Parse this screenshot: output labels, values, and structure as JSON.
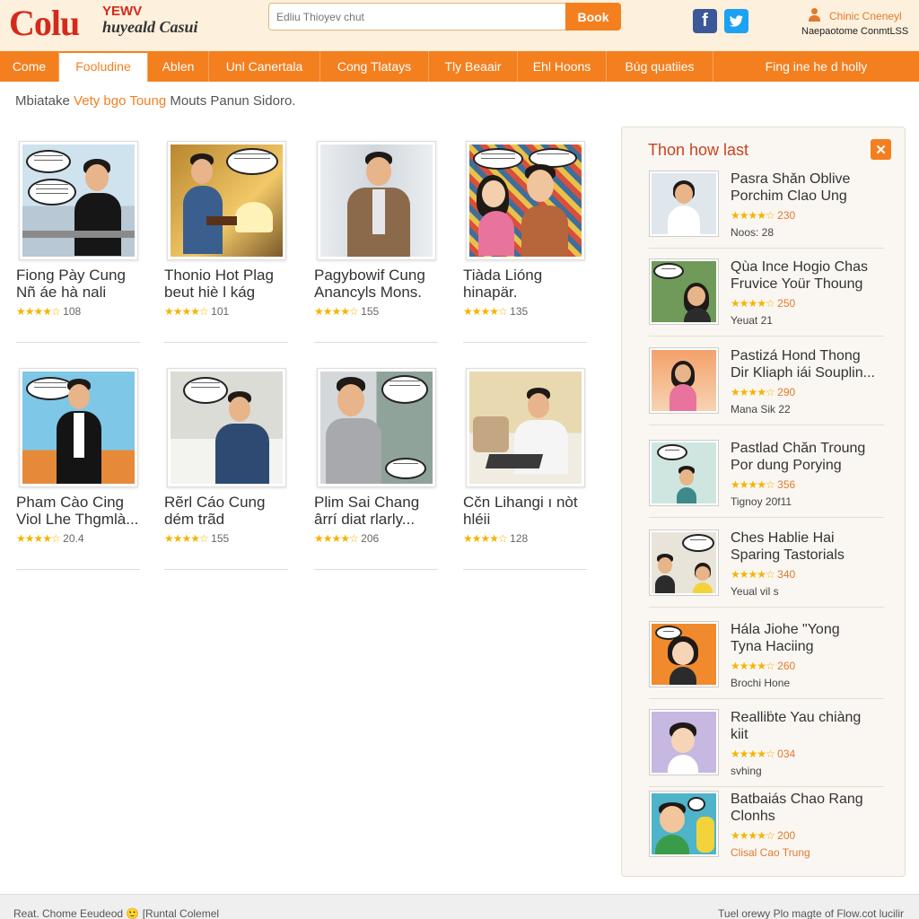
{
  "header": {
    "logo_main": "Colu",
    "logo_top": "YEWV",
    "logo_sub": "huyeald Casui",
    "search_placeholder": "Edliu Thioyev chut",
    "search_button": "Book",
    "social": [
      {
        "icon": "facebook-icon",
        "glyph": "f",
        "color": "#3b5998"
      },
      {
        "icon": "twitter-icon",
        "glyph": "t",
        "color": "#1da1f2"
      }
    ],
    "user_name": "Chinic Cneneyl",
    "user_sub": "Naepaotome ConmtLSS"
  },
  "nav": {
    "items": [
      {
        "label": "Come"
      },
      {
        "label": "Fooludine",
        "active": true
      },
      {
        "label": "Ablen"
      },
      {
        "label": "Unl Canertala"
      },
      {
        "label": "Cong Tlatays"
      },
      {
        "label": "Tly Beaair"
      },
      {
        "label": "Ehl Hoons"
      },
      {
        "label": "Búg quatiies"
      },
      {
        "label": "Fing ine he d holly"
      }
    ]
  },
  "breadcrumb": {
    "before": "Mbiatake ",
    "highlight": "Vety bgo Toung",
    "after": " Mouts Panun Sidoro."
  },
  "grid": [
    {
      "title1": "Fiong Pày Cung",
      "title2": "Nñ áe hà nali",
      "rating": "★★★★☆",
      "count": "108",
      "scene": "bubbles-office"
    },
    {
      "title1": "Thonio Hot Plag",
      "title2": "beut hiè l kág",
      "rating": "★★★★☆",
      "count": "101",
      "scene": "lamp-room"
    },
    {
      "title1": "Pagybowif Cung",
      "title2": "Anancyls Mons.",
      "rating": "★★★★☆",
      "count": "155",
      "scene": "office-jacket"
    },
    {
      "title1": "Tiàda Lióng",
      "title2": "hinapär.",
      "rating": "★★★★☆",
      "count": "135",
      "scene": "comic-couple"
    },
    {
      "title1": "Pham Cào Cing",
      "title2": "Viol Lhe Thgmlà...",
      "rating": "★★★★☆",
      "count": "20.4",
      "scene": "colorful-suit"
    },
    {
      "title1": "Rẽrl Cáo Cung",
      "title2": "dém trãd",
      "rating": "★★★★☆",
      "count": "155",
      "scene": "kitchen-shirt"
    },
    {
      "title1": "Plim Sai Chang",
      "title2": "ârrí diat rlarly...",
      "rating": "★★★★☆",
      "count": "206",
      "scene": "window-suit"
    },
    {
      "title1": "Cčn Lihangi ı nòt",
      "title2": "hléii",
      "rating": "★★★★☆",
      "count": "128",
      "scene": "laptop-sofa"
    }
  ],
  "sidebar": {
    "title": "Thon how last",
    "close_glyph": "✕",
    "items": [
      {
        "title1": "Pasra Shǎn Oblive",
        "title2": "Porchim Clao Ung",
        "rating": "★★★★☆",
        "count": "230",
        "sub": "Noos: 28",
        "scene": "sofa-woman"
      },
      {
        "title1": "Qùa Ince Hogio Chas",
        "title2": "Fruvice Yoür Thoung",
        "rating": "★★★★☆",
        "count": "250",
        "sub": "Yeuat 21",
        "scene": "park-girl"
      },
      {
        "title1": "Pastizá Hond Thong",
        "title2": "Dir Kliaph iái Souplin...",
        "rating": "★★★★☆",
        "count": "290",
        "sub": "Mana Sik 22",
        "scene": "shop-girl"
      },
      {
        "title1": "Pastlad Chăn Troung",
        "title2": "Por dung Porying",
        "rating": "★★★★☆",
        "count": "356",
        "sub": "Tignoy 20f11",
        "scene": "classroom"
      },
      {
        "title1": "Ches Hablie Hai",
        "title2": "Sparing Tastorials",
        "rating": "★★★★☆",
        "count": "340",
        "sub": "Yeual vil s",
        "scene": "tablet"
      },
      {
        "title1": "Hála Jiohe \"Yong",
        "title2": "Tyna Haciing",
        "rating": "★★★★☆",
        "count": "260",
        "sub": "Brochi Hone",
        "scene": "orange-girl"
      },
      {
        "title1": "Realliḃte Yau chiàng",
        "title2": "kiit",
        "rating": "★★★★☆",
        "count": "034",
        "sub": "svhing",
        "scene": "lavender-boy"
      },
      {
        "title1": "Batbaiás Chao Rang",
        "title2": "Clonhs",
        "rating": "★★★★☆",
        "count": "200",
        "sub": "Clisal Cao Trung",
        "scene": "green-boy"
      }
    ]
  },
  "footer": {
    "left": "Reat. Chome Eeudeod 🙂 [Runtal Colemel",
    "right": "Tuel orewy Plo magte of Flow.cot lucilir"
  }
}
